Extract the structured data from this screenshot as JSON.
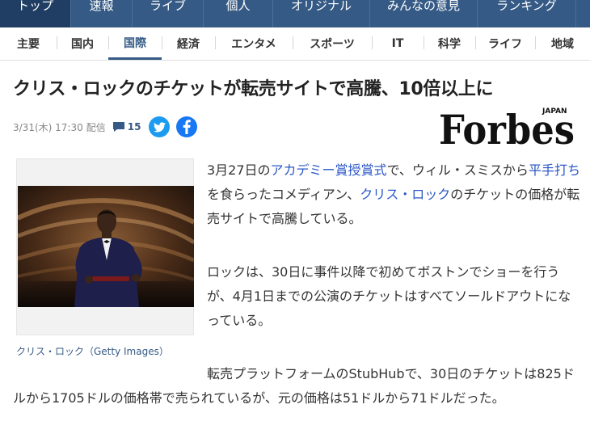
{
  "top_nav": [
    {
      "label": "トップ",
      "active": true
    },
    {
      "label": "速報",
      "active": false
    },
    {
      "label": "ライブ",
      "active": false
    },
    {
      "label": "個人",
      "active": false
    },
    {
      "label": "オリジナル",
      "active": false
    },
    {
      "label": "みんなの意見",
      "active": false
    },
    {
      "label": "ランキング",
      "active": false
    }
  ],
  "sub_nav": [
    {
      "label": "主要",
      "active": false
    },
    {
      "label": "国内",
      "active": false
    },
    {
      "label": "国際",
      "active": true
    },
    {
      "label": "経済",
      "active": false
    },
    {
      "label": "エンタメ",
      "active": false
    },
    {
      "label": "スポーツ",
      "active": false
    },
    {
      "label": "IT",
      "active": false
    },
    {
      "label": "科学",
      "active": false
    },
    {
      "label": "ライフ",
      "active": false
    },
    {
      "label": "地域",
      "active": false
    }
  ],
  "article": {
    "headline": "クリス・ロックのチケットが転売サイトで高騰、10倍以上に",
    "date": "3/31(木) 17:30",
    "distributed": "配信",
    "comment_count": "15",
    "publisher_logo_text": "Forbes",
    "publisher_logo_sub": "JAPAN",
    "photo_caption": "クリス・ロック（Getty Images）",
    "p1": {
      "t1": "3月27日の",
      "link1": "アカデミー賞授賞式",
      "t2": "で、ウィル・スミスから",
      "link2": "平手打ち",
      "t3": "を食らったコメディアン、",
      "link3": "クリス・ロック",
      "t4": "のチケットの価格が転売サイトで高騰している。"
    },
    "p2": "ロックは、30日に事件以降で初めてボストンでショーを行うが、4月1日までの公演のチケットはすべてソールドアウトになっている。",
    "p3": "転売プラットフォームのStubHubで、30日のチケットは825ドルから1705ドルの価格帯で売られているが、元の価格は51ドルから71ドルだった。"
  },
  "colors": {
    "nav_bg": "#355a85",
    "nav_active": "#203e63",
    "link": "#2a56c6",
    "twitter": "#1d9bf0",
    "facebook": "#1877f2"
  }
}
